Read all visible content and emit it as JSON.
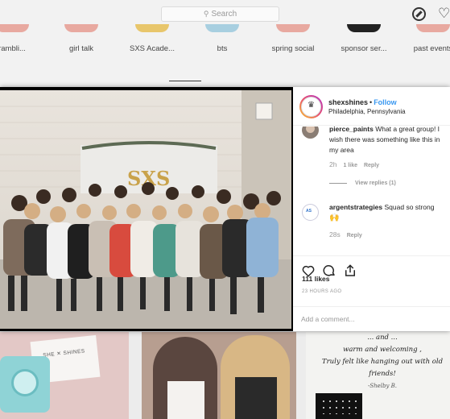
{
  "topbar": {
    "search_placeholder": "Search",
    "search_icon": "magnifier-icon",
    "explore_icon": "compass-icon",
    "activity_icon": "heart-icon"
  },
  "highlights": [
    {
      "label": "rambli...",
      "color": "#e8a9a0"
    },
    {
      "label": "girl talk",
      "color": "#e8a9a0"
    },
    {
      "label": "SXS Acade...",
      "color": "#e8c66b"
    },
    {
      "label": "bts",
      "color": "#a8cfe0"
    },
    {
      "label": "spring social",
      "color": "#e8a9a0"
    },
    {
      "label": "sponsor ser...",
      "color": "#222222"
    },
    {
      "label": "past events",
      "color": "#e8a9a0"
    }
  ],
  "post": {
    "username": "shexshines",
    "follow_label": "Follow",
    "location": "Philadelphia, Pennsylvania",
    "photo_sign_text": "SXS",
    "comments": [
      {
        "user": "pierce_paints",
        "text": "What a great group! I wish there was something like this in my area",
        "age": "2h",
        "likes": "1 like",
        "reply": "Reply",
        "view_replies": "View replies (1)"
      },
      {
        "user": "argentstrategies",
        "text": "Squad so strong",
        "emoji": "🙌",
        "age": "28s",
        "reply": "Reply"
      }
    ],
    "likes_count": "111 likes",
    "time_ago": "23 HOURS AGO",
    "add_comment_placeholder": "Add a comment..."
  },
  "background_posts": {
    "card_stamp": "SHE ✕ SHINES",
    "quote_lines": [
      "... and ...",
      "warm and welcoming ,",
      "Truly felt like hanging out with old friends!",
      "-Shelby B."
    ]
  },
  "colors": {
    "accent": "#3897f0",
    "text": "#262626",
    "muted": "#999999"
  }
}
